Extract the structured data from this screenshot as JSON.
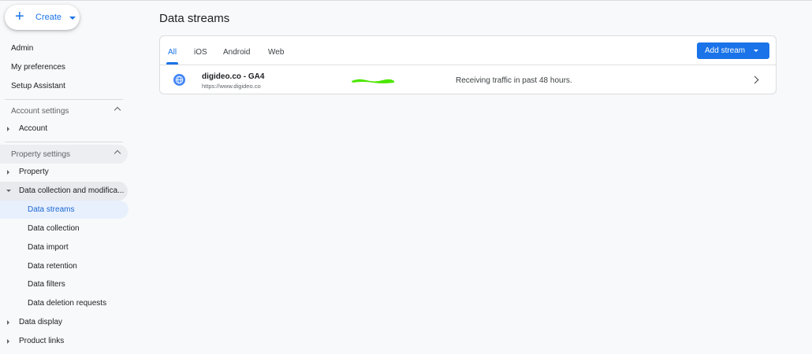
{
  "create": {
    "label": "Create",
    "icon": "plus-icon"
  },
  "sidebar": {
    "top_links": [
      "Admin",
      "My preferences",
      "Setup Assistant"
    ],
    "account_settings": {
      "label": "Account settings",
      "items": [
        "Account"
      ]
    },
    "property_settings": {
      "label": "Property settings",
      "items": [
        "Property",
        "Data collection and modifica..."
      ],
      "sub_items": [
        "Data streams",
        "Data collection",
        "Data import",
        "Data retention",
        "Data filters",
        "Data deletion requests"
      ],
      "after_items": [
        "Data display",
        "Product links"
      ]
    }
  },
  "main": {
    "title": "Data streams",
    "tabs": [
      "All",
      "iOS",
      "Android",
      "Web"
    ],
    "active_tab": "All",
    "add_stream_label": "Add stream",
    "streams": [
      {
        "name": "digideo.co - GA4",
        "url": "https://www.digideo.co",
        "status": "Receiving traffic in past 48 hours.",
        "icon": "globe-icon"
      }
    ]
  },
  "colors": {
    "accent": "#1a73e8",
    "active_bg": "#e8f0fe",
    "redaction": "#4ce600"
  }
}
